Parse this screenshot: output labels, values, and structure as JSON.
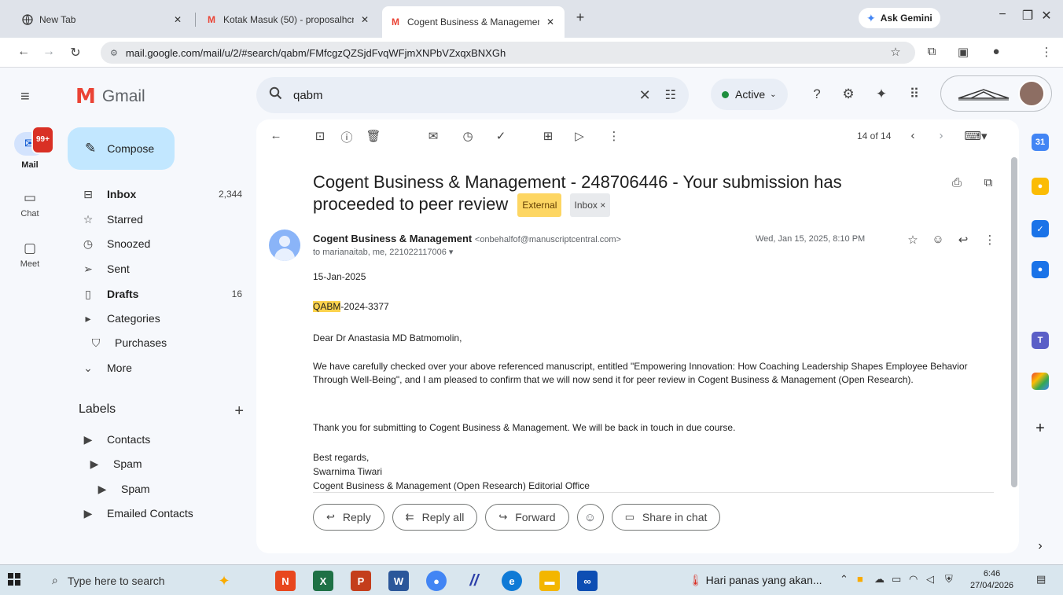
{
  "browser": {
    "tabs": [
      {
        "title": "New Tab",
        "icon": "globe-icon"
      },
      {
        "title": "Kotak Masuk (50) - proposalhcn",
        "icon": "gmail-icon"
      },
      {
        "title": "Cogent Business & Managemer",
        "icon": "gmail-icon"
      }
    ],
    "new_tab": "+",
    "gemini_label": "Ask Gemini",
    "url": "mail.google.com/mail/u/2/#search/qabm/FMfcgzQZSjdFvqWFjmXNPbVZxqxBNXGh"
  },
  "gmail": {
    "app_name": "Gmail",
    "search_value": "qabm",
    "status": "Active",
    "rail": {
      "mail_label": "Mail",
      "mail_badge": "99+",
      "chat_label": "Chat",
      "meet_label": "Meet"
    },
    "compose_label": "Compose",
    "nav": {
      "inbox": {
        "label": "Inbox",
        "count": "2,344"
      },
      "starred": {
        "label": "Starred"
      },
      "snoozed": {
        "label": "Snoozed"
      },
      "sent": {
        "label": "Sent"
      },
      "drafts": {
        "label": "Drafts",
        "count": "16"
      },
      "categories": {
        "label": "Categories"
      },
      "purchases": {
        "label": "Purchases"
      },
      "more": {
        "label": "More"
      }
    },
    "labels_heading": "Labels",
    "labels": [
      {
        "label": "Contacts"
      },
      {
        "label": "Spam"
      },
      {
        "label": "Spam"
      },
      {
        "label": "Emailed Contacts"
      }
    ],
    "toolbar": {
      "pager": "14 of 14"
    },
    "email": {
      "subject": "Cogent Business & Management - 248706446 - Your submission has proceeded to peer review",
      "tag_external": "External",
      "tag_inbox": "Inbox ×",
      "sender_name": "Cogent Business & Management",
      "sender_email": "<onbehalfof@manuscriptcentral.com>",
      "to": "to marianaitab, me, 221022117006",
      "date": "Wed, Jan 15, 2025, 8:10 PM",
      "date_line": "15-Jan-2025",
      "ref_highlight": "QABM",
      "ref_rest": "-2024-3377",
      "greeting": "Dear Dr Anastasia MD  Batmomolin,",
      "para1": "We have carefully checked over your above referenced manuscript, entitled \"Empowering Innovation: How Coaching Leadership  Shapes Employee Behavior Through Well-Being\", and I am pleased to confirm that we will now send it for peer review in Cogent Business & Management (Open Research).",
      "para2": "Thank you for submitting to Cogent Business & Management. We will be back in touch in due course.",
      "signoff": "Best regards,",
      "signer": "Swarnima Tiwari",
      "office": "Cogent Business & Management (Open Research) Editorial Office"
    },
    "actions": {
      "reply": "Reply",
      "reply_all": "Reply all",
      "forward": "Forward",
      "share": "Share in chat"
    }
  },
  "taskbar": {
    "search_placeholder": "Type here to search",
    "weather": "Hari panas yang akan...",
    "time": "6:46",
    "date": "27/04/2026"
  },
  "colors": {
    "compose_bg": "#c2e7ff",
    "highlight": "#fcd34d",
    "external_tag": "#fdd663",
    "active_dot": "#1e8e3e",
    "badge": "#d93025"
  }
}
